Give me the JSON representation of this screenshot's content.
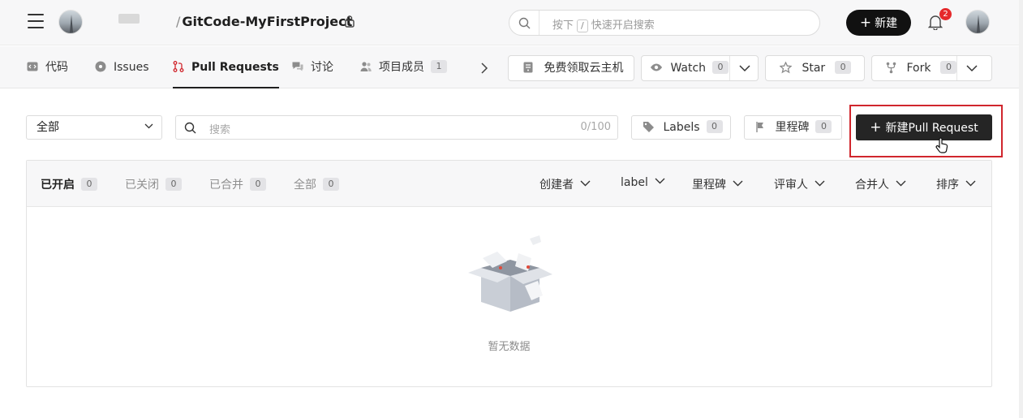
{
  "header": {
    "repo_name": "GitCode-MyFirstProject",
    "slash": "/",
    "search": {
      "prefix": "按下",
      "key": "/",
      "suffix": "快速开启搜索"
    },
    "new_button": "新建",
    "notification_count": "2"
  },
  "nav": {
    "tabs": [
      {
        "label": "代码"
      },
      {
        "label": "Issues"
      },
      {
        "label": "Pull Requests"
      },
      {
        "label": "讨论"
      },
      {
        "label": "项目成员",
        "count": "1"
      }
    ],
    "actions": {
      "cloud": "免费领取云主机",
      "watch": {
        "label": "Watch",
        "count": "0"
      },
      "star": {
        "label": "Star",
        "count": "0"
      },
      "fork": {
        "label": "Fork",
        "count": "0"
      }
    }
  },
  "filters": {
    "scope": "全部",
    "search_placeholder": "搜索",
    "search_counter": "0/100",
    "labels": {
      "label": "Labels",
      "count": "0"
    },
    "milestone": {
      "label": "里程碑",
      "count": "0"
    },
    "create_button": "新建Pull Request"
  },
  "list": {
    "state_tabs": [
      {
        "label": "已开启",
        "count": "0"
      },
      {
        "label": "已关闭",
        "count": "0"
      },
      {
        "label": "已合并",
        "count": "0"
      },
      {
        "label": "全部",
        "count": "0"
      }
    ],
    "dropdowns": [
      "创建者",
      "label",
      "里程碑",
      "评审人",
      "合并人",
      "排序"
    ],
    "empty_text": "暂无数据"
  },
  "colors": {
    "accent_dark": "#252525",
    "highlight_box": "#d0262d",
    "badge_red": "#e5292b"
  }
}
